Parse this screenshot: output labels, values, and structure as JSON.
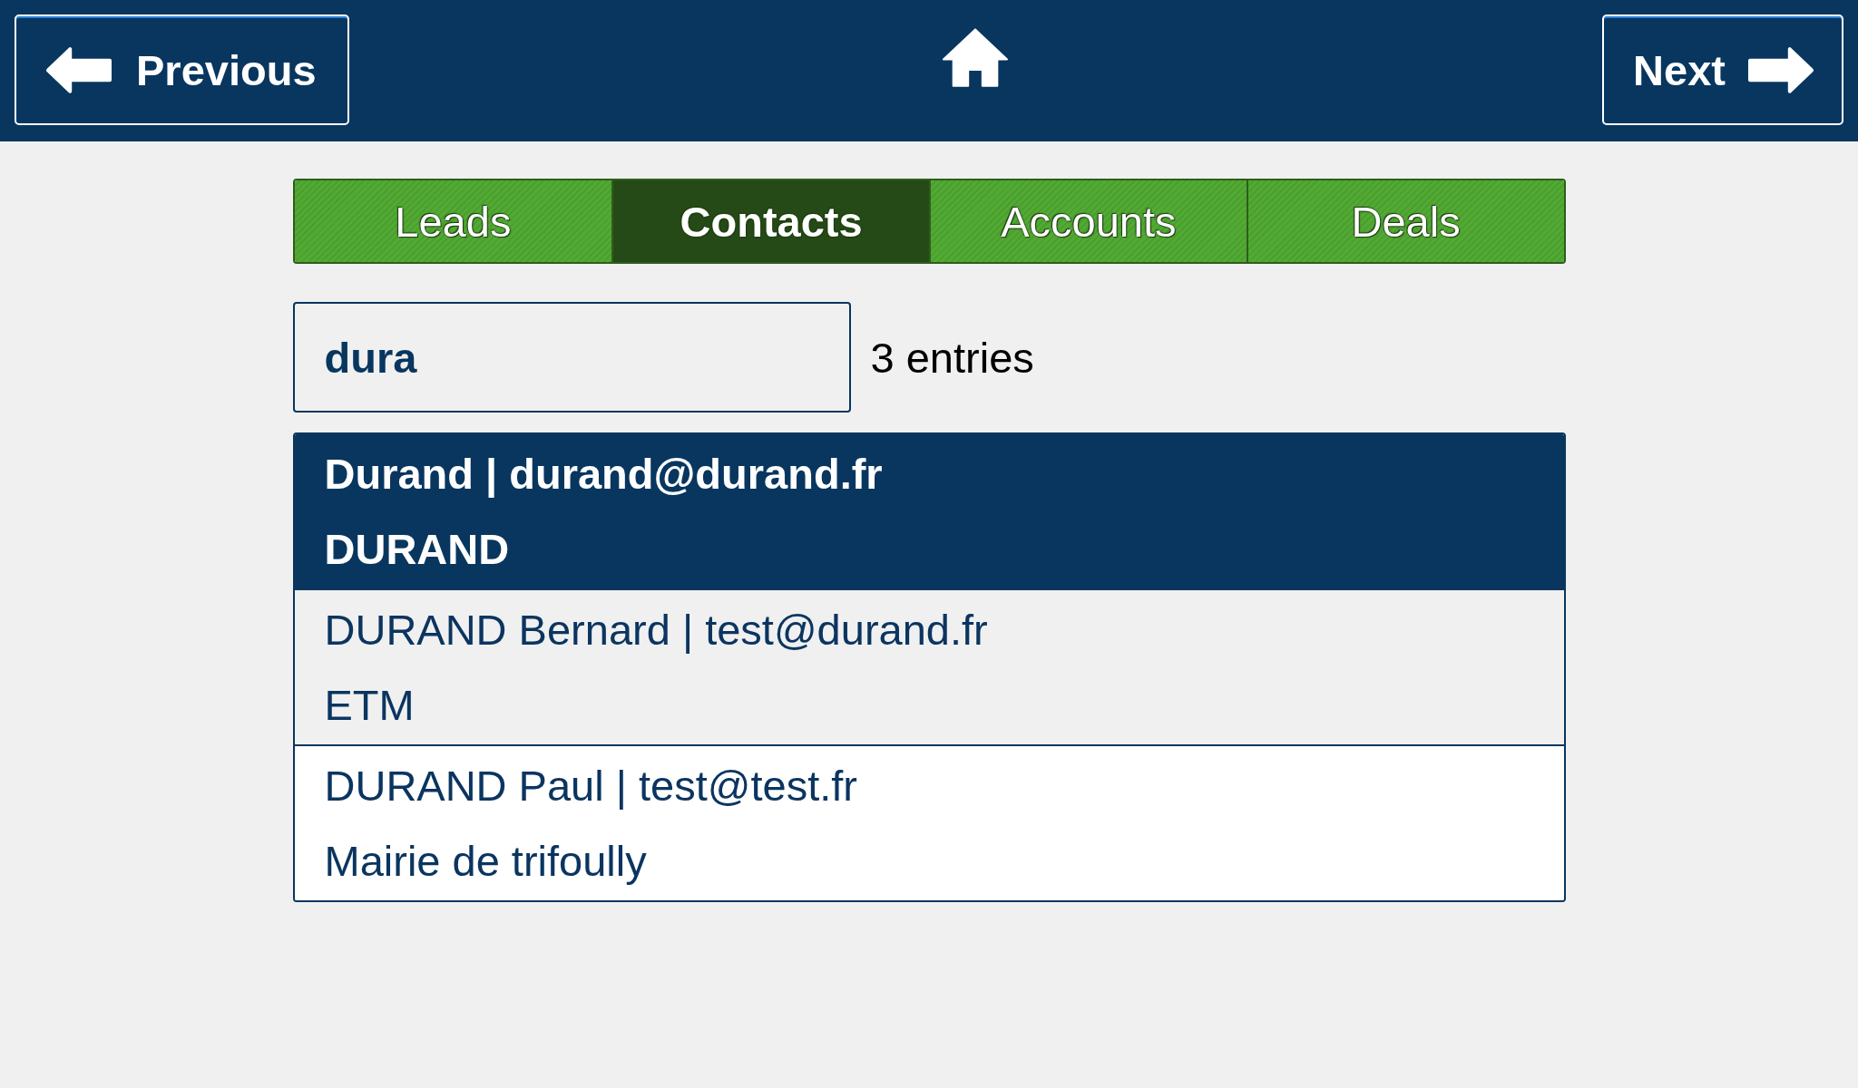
{
  "nav": {
    "previous": {
      "label": "Previous"
    },
    "next": {
      "label": "Next"
    }
  },
  "tabs": [
    {
      "label": "Leads",
      "selected": false
    },
    {
      "label": "Contacts",
      "selected": true
    },
    {
      "label": "Accounts",
      "selected": false
    },
    {
      "label": "Deals",
      "selected": false
    }
  ],
  "search": {
    "value": "dura"
  },
  "result_count": "3 entries",
  "results": [
    {
      "title": "Durand | durand@durand.fr",
      "subtitle": "DURAND",
      "selected": true,
      "hovered": false
    },
    {
      "title": "DURAND Bernard | test@durand.fr",
      "subtitle": "ETM",
      "selected": false,
      "hovered": true
    },
    {
      "title": "DURAND Paul | test@test.fr",
      "subtitle": "Mairie de trifoully",
      "selected": false,
      "hovered": false
    }
  ]
}
